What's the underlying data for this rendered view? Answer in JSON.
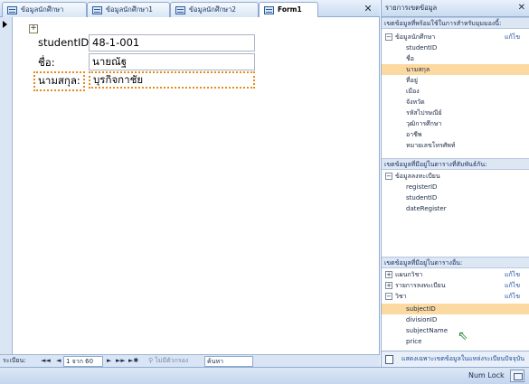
{
  "tabs": [
    {
      "label": "ข้อมูลนักศึกษา",
      "active": false
    },
    {
      "label": "ข้อมูลนักศึกษา1",
      "active": false
    },
    {
      "label": "ข้อมูลนักศึกษา2",
      "active": false
    },
    {
      "label": "Form1",
      "active": true
    }
  ],
  "form": {
    "fields": [
      {
        "label": "studentID:",
        "value": "48-1-001"
      },
      {
        "label": "ชื่อ:",
        "value": "นายณัฐ"
      },
      {
        "label": "นามสกุล:",
        "value": "บุรกิจกาชัย",
        "focused": true
      }
    ]
  },
  "navigator": {
    "record_label": "ระเบียน:",
    "first": "◄◄",
    "prev": "◄",
    "position": "1 จาก 60",
    "next": "►",
    "last": "►►",
    "new": "►✱",
    "filter": "ไม่มีตัวกรอง",
    "search": "ค้นหา"
  },
  "field_list": {
    "title": "รายการเขตข้อมูล",
    "section_available": "เขตข้อมูลที่พร้อมใช้ในการสำหรับมุมมองนี้:",
    "table_main": "ข้อมูลนักศึกษา",
    "edit_label": "แก้ไข",
    "main_fields": [
      "studentID",
      "ชื่อ",
      "นามสกุล",
      "ที่อยู่",
      "เมือง",
      "จังหวัด",
      "รหัสไปรษณีย์",
      "วุฒิการศึกษา",
      "อาชีพ",
      "หมายเลขโทรศัพท์"
    ],
    "highlighted_main": "นามสกุล",
    "section_related": "เขตข้อมูลที่มีอยู่ในตารางที่สัมพันธ์กัน:",
    "table_related": "ข้อมูลลงทะเบียน",
    "related_fields": [
      "registerID",
      "studentID",
      "dateRegister"
    ],
    "section_other": "เขตข้อมูลที่มีอยู่ในตารางอื่น:",
    "other_tables": [
      {
        "name": "แผนกวิชา",
        "expanded": false
      },
      {
        "name": "รายการลงทะเบียน",
        "expanded": false
      },
      {
        "name": "วิชา",
        "expanded": true
      }
    ],
    "other_fields": [
      "subjectID",
      "divisionID",
      "subjectName",
      "price"
    ],
    "highlighted_other": "subjectID",
    "footer": "แสดงเฉพาะเขตข้อมูลในแหล่งระเบียนปัจจุบัน"
  },
  "statusbar": {
    "numlock": "Num Lock"
  }
}
